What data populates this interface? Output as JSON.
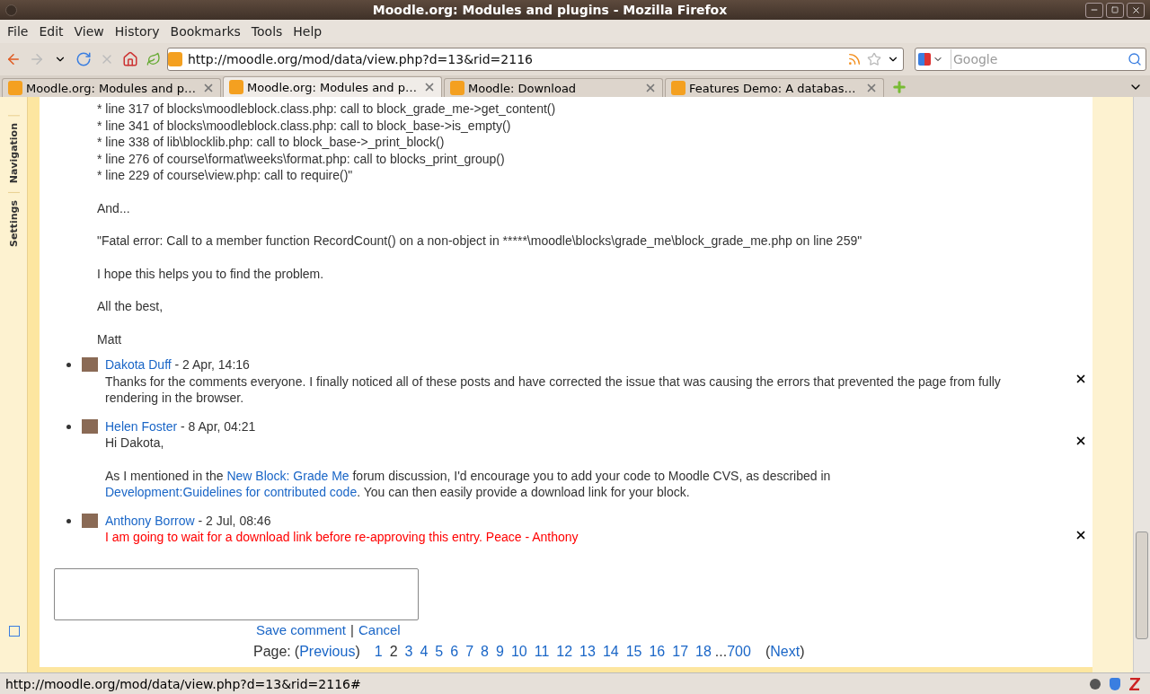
{
  "window": {
    "title": "Moodle.org: Modules and plugins - Mozilla Firefox"
  },
  "menu": [
    "File",
    "Edit",
    "View",
    "History",
    "Bookmarks",
    "Tools",
    "Help"
  ],
  "address": {
    "value": "http://moodle.org/mod/data/view.php?d=13&rid=2116"
  },
  "search": {
    "placeholder": "Google"
  },
  "tabs": [
    {
      "label": "Moodle.org: Modules and p…",
      "selected": false
    },
    {
      "label": "Moodle.org: Modules and p…",
      "selected": true
    },
    {
      "label": "Moodle: Download",
      "selected": false
    },
    {
      "label": "Features Demo: A databas…",
      "selected": false
    }
  ],
  "side_tabs": [
    "Navigation",
    "Settings"
  ],
  "post": {
    "trace_lines": [
      "* line 317 of blocks\\moodleblock.class.php: call to block_grade_me->get_content()",
      "* line 341 of blocks\\moodleblock.class.php: call to block_base->is_empty()",
      "* line 338 of lib\\blocklib.php: call to block_base->_print_block()",
      "* line 276 of course\\format\\weeks\\format.php: call to blocks_print_group()",
      "* line 229 of course\\view.php: call to require()\""
    ],
    "paragraphs": [
      "And...",
      "\"Fatal error: Call to a member function RecordCount() on a non-object in *****\\moodle\\blocks\\grade_me\\block_grade_me.php on line 259\"",
      "I hope this helps you to find the problem.",
      "All the best,",
      "Matt"
    ]
  },
  "comments": [
    {
      "author": "Dakota Duff",
      "date": "- 2 Apr, 14:16",
      "highlighted": false,
      "paragraphs": [
        [
          {
            "kind": "text",
            "text": "Thanks for the comments everyone. I finally noticed all of these posts and have corrected the issue that was causing the errors that prevented the page from fully rendering in the browser."
          }
        ]
      ]
    },
    {
      "author": "Helen Foster",
      "date": "- 8 Apr, 04:21",
      "highlighted": false,
      "paragraphs": [
        [
          {
            "kind": "text",
            "text": "Hi Dakota,"
          }
        ],
        [
          {
            "kind": "text",
            "text": "As I mentioned in the "
          },
          {
            "kind": "link",
            "text": "New Block: Grade Me"
          },
          {
            "kind": "text",
            "text": " forum discussion, I'd encourage you to add your code to Moodle CVS, as described in "
          },
          {
            "kind": "link",
            "text": "Development:Guidelines for contributed code"
          },
          {
            "kind": "text",
            "text": ". You can then easily provide a download link for your block."
          }
        ]
      ]
    },
    {
      "author": "Anthony Borrow",
      "date": "- 2 Jul, 08:46",
      "highlighted": true,
      "paragraphs": [
        [
          {
            "kind": "text",
            "text": "I am going to wait for a download link before re-approving this entry. Peace - Anthony"
          }
        ]
      ]
    }
  ],
  "comment_form": {
    "save": "Save comment",
    "separator": "|",
    "cancel": "Cancel"
  },
  "pagination": {
    "label": "Page:",
    "open": "(",
    "previous": "Previous",
    "close": ")",
    "pages": [
      {
        "label": "1",
        "selected": false
      },
      {
        "label": "2",
        "selected": true
      },
      {
        "label": "3",
        "selected": false
      },
      {
        "label": "4",
        "selected": false
      },
      {
        "label": "5",
        "selected": false
      },
      {
        "label": "6",
        "selected": false
      },
      {
        "label": "7",
        "selected": false
      },
      {
        "label": "8",
        "selected": false
      },
      {
        "label": "9",
        "selected": false
      },
      {
        "label": "10",
        "selected": false
      },
      {
        "label": "11",
        "selected": false
      },
      {
        "label": "12",
        "selected": false
      },
      {
        "label": "13",
        "selected": false
      },
      {
        "label": "14",
        "selected": false
      },
      {
        "label": "15",
        "selected": false
      },
      {
        "label": "16",
        "selected": false
      },
      {
        "label": "17",
        "selected": false
      },
      {
        "label": "18",
        "selected": false
      }
    ],
    "ellipsis": "...",
    "last": "700",
    "next_open": "(",
    "next": "Next",
    "next_close": ")"
  },
  "status_bar": {
    "text": "http://moodle.org/mod/data/view.php?d=13&rid=2116#"
  }
}
